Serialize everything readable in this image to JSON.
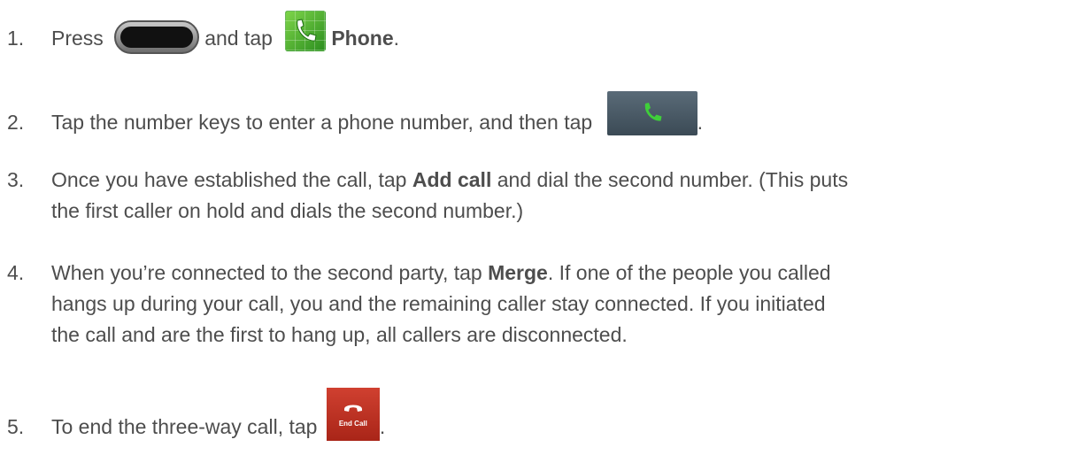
{
  "steps": [
    {
      "number": "1.",
      "parts": {
        "a": "Press",
        "b": "and tap",
        "bold": "Phone",
        "c": "."
      },
      "icons": [
        "home-key-icon",
        "phone-app-icon"
      ]
    },
    {
      "number": "2.",
      "parts": {
        "a": "Tap the number keys to enter a phone number, and then tap",
        "c": "."
      },
      "icons": [
        "dial-key-icon"
      ]
    },
    {
      "number": "3.",
      "parts": {
        "a": "Once you have established the call, tap",
        "bold": "Add call",
        "b": "and dial the second number. (This puts",
        "line2": "the first caller on hold and dials the second number.)"
      }
    },
    {
      "number": "4.",
      "parts": {
        "a": "When you’re connected to the second party, tap",
        "bold": "Merge",
        "b": ". If one of the people you called",
        "line2": "hangs up during your call, you and the remaining caller stay connected. If you initiated",
        "line3": "the call and are the first to hang up, all callers are disconnected."
      }
    },
    {
      "number": "5.",
      "parts": {
        "a": "To end the three-way call, tap",
        "c": "."
      },
      "icons": [
        "end-call-icon"
      ],
      "end_call_label": "End Call"
    }
  ],
  "colors": {
    "text": "#4d4d4d",
    "end_call": "#b83224",
    "dial_key": "#4a5a66",
    "phone_app": "#4cb336"
  }
}
